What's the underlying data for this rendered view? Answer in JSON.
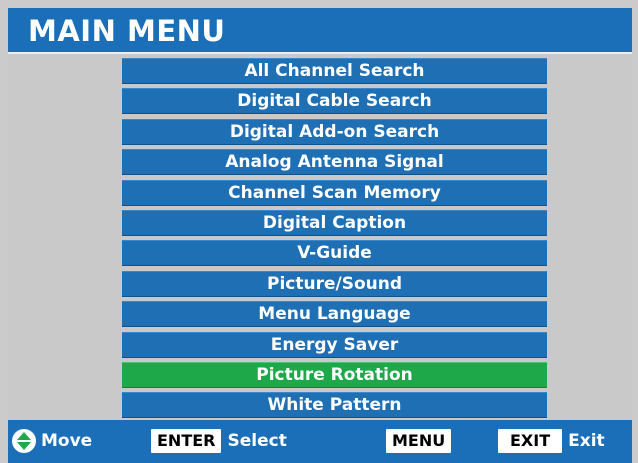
{
  "header": {
    "title": "MAIN MENU"
  },
  "menu": {
    "items": [
      {
        "label": "All Channel Search"
      },
      {
        "label": "Digital Cable Search"
      },
      {
        "label": "Digital Add-on Search"
      },
      {
        "label": "Analog Antenna Signal"
      },
      {
        "label": "Channel Scan Memory"
      },
      {
        "label": "Digital Caption"
      },
      {
        "label": "V-Guide"
      },
      {
        "label": "Picture/Sound"
      },
      {
        "label": "Menu Language"
      },
      {
        "label": "Energy Saver"
      },
      {
        "label": "Picture Rotation"
      },
      {
        "label": "White Pattern"
      }
    ],
    "selected_index": 10
  },
  "footer": {
    "move_icon": "up-down-arrows-icon",
    "move_label": "Move",
    "enter_key": "ENTER",
    "select_label": "Select",
    "menu_key": "MENU",
    "exit_key": "EXIT",
    "exit_label": "Exit"
  },
  "colors": {
    "header_blue": "#1a6fb8",
    "item_blue": "#1f6fb5",
    "selected_green": "#1fa84a",
    "background_gray": "#c9c9c9"
  }
}
